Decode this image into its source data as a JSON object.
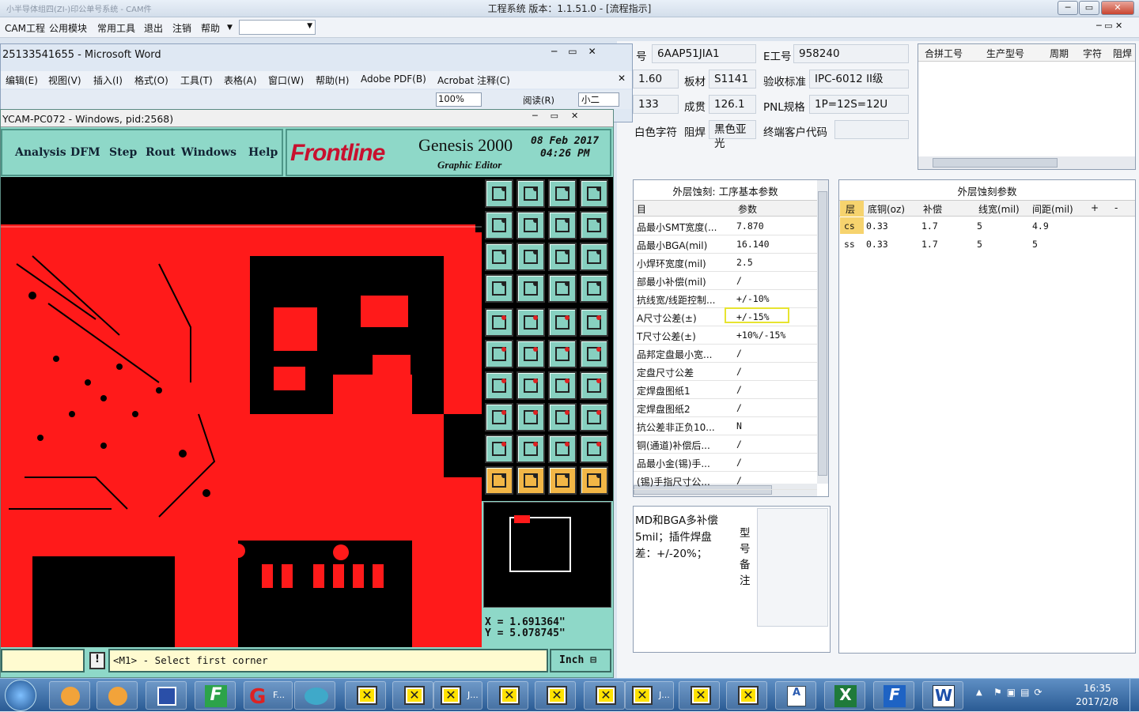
{
  "app": {
    "title": "工程系统   版本：1.1.51.0 - [流程指示]",
    "faded_title": "小半导体组四(ZI-)印公单号系统 - CAM件",
    "menu": [
      "CAM工程",
      "公用模块",
      "常用工具",
      "退出",
      "注销",
      "帮助"
    ]
  },
  "panel": {
    "f1": {
      "label": "号",
      "value": "6AAP51JIA1"
    },
    "f2": {
      "label": "E工号",
      "value": "958240"
    },
    "f3": {
      "value": "1.60"
    },
    "f4": {
      "label": "板材",
      "value": "S1141"
    },
    "f5": {
      "label": "验收标准",
      "value": "IPC-6012 II级"
    },
    "f6": {
      "value": "133"
    },
    "f7": {
      "label": "成贯",
      "value": "126.1"
    },
    "f8": {
      "label": "PNL规格",
      "value": "1P=12S=12U"
    },
    "f9": {
      "label": "白色字符"
    },
    "f10": {
      "label": "阻焊",
      "value": "黑色亚光"
    },
    "f11": {
      "label": "终端客户代码"
    },
    "top_grid_headers": [
      "合拼工号",
      "生产型号",
      "周期",
      "字符",
      "阻焊"
    ],
    "left_grid": {
      "title": "外层蚀刻: 工序基本参数",
      "headers": [
        "目",
        "参数"
      ],
      "rows": [
        [
          "品最小SMT宽度(...",
          "7.870"
        ],
        [
          "品最小BGA(mil)",
          "16.140"
        ],
        [
          "小焊环宽度(mil)",
          "2.5"
        ],
        [
          "部最小补偿(mil)",
          "/"
        ],
        [
          "抗线宽/线距控制...",
          "+/-10%"
        ],
        [
          "A尺寸公差(±)",
          "+/-15%"
        ],
        [
          "T尺寸公差(±)",
          "+10%/-15%"
        ],
        [
          "品邦定盘最小宽...",
          "/"
        ],
        [
          "定盘尺寸公差",
          "/"
        ],
        [
          "定焊盘图纸1",
          "/"
        ],
        [
          "定焊盘图纸2",
          "/"
        ],
        [
          "抗公差非正负10...",
          "N"
        ],
        [
          "铜(通道)补偿后...",
          "/"
        ],
        [
          "品最小金(锡)手...",
          "/"
        ],
        [
          "(锡)手指尺寸公...",
          "/"
        ]
      ]
    },
    "right_grid": {
      "title": "外层蚀刻参数",
      "headers": [
        "层",
        "底铜(oz)",
        "补偿",
        "线宽(mil)",
        "间距(mil)",
        "+",
        "-"
      ],
      "rows": [
        [
          "cs",
          "0.33",
          "1.7",
          "5",
          "4.9"
        ],
        [
          "ss",
          "0.33",
          "1.7",
          "5",
          "5"
        ]
      ]
    },
    "notes": {
      "lines": [
        "MD和BGA多补偿",
        "5mil；插件焊盘",
        "差：+/-20%；"
      ],
      "side_label": "型号备注"
    }
  },
  "word": {
    "title": "25133541655 - Microsoft Word",
    "menu": [
      "编辑(E)",
      "视图(V)",
      "插入(I)",
      "格式(O)",
      "工具(T)",
      "表格(A)",
      "窗口(W)",
      "帮助(H)",
      "Adobe PDF(B)",
      "Acrobat 注释(C)"
    ],
    "zoom": "100%",
    "read": "阅读(R)",
    "font_size": "小二"
  },
  "genesis": {
    "title": "YCAM-PC072 - Windows, pid:2568)",
    "menu": [
      "Analysis",
      "DFM",
      "Step",
      "Rout",
      "Windows",
      "Help"
    ],
    "brand": "Frontline",
    "product": "Genesis 2000",
    "subtitle": "Graphic Editor",
    "date": "08 Feb 2017",
    "time": "04:26 PM",
    "x": "X = 1.691364\"",
    "y": "Y = 5.078745\"",
    "status": "<M1> - Select first corner",
    "units": "Inch"
  },
  "taskbar": {
    "clock": "16:35",
    "date": "2017/2/8",
    "labels": [
      "F...",
      "J...",
      "J..."
    ]
  }
}
